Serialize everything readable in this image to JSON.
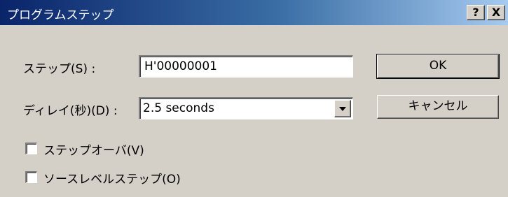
{
  "window": {
    "title": "プログラムステップ",
    "help_label": "?",
    "close_label": "X"
  },
  "step": {
    "label": "ステップ(S) :",
    "value": "H'00000001"
  },
  "delay": {
    "label": "ディレイ(秒)(D) :",
    "value": "2.5 seconds"
  },
  "buttons": {
    "ok_label": "OK",
    "cancel_label": "キャンセル"
  },
  "checkboxes": [
    {
      "label": "ステップオーバ(V)",
      "checked": false
    },
    {
      "label": "ソースレベルステップ(O)",
      "checked": false
    }
  ],
  "colors": {
    "titlebar_start": "#0a246a",
    "titlebar_end": "#a6caf0",
    "dialog_bg": "#d4d0c8"
  }
}
